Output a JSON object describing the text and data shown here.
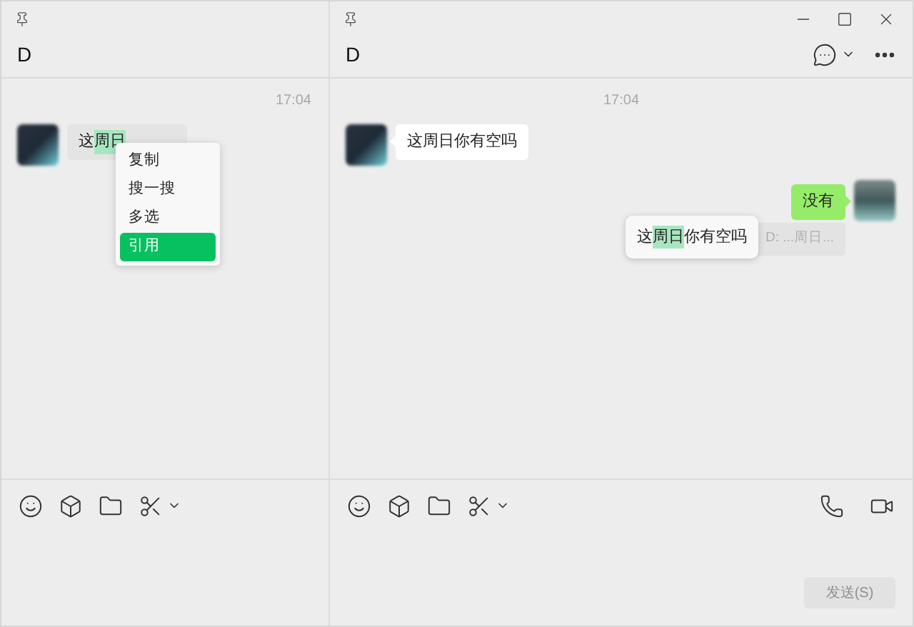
{
  "left_chat": {
    "title": "D",
    "timestamp": "17:04",
    "message": {
      "prefix": "这",
      "highlight": "周日"
    },
    "context_menu": [
      {
        "label": "复制",
        "selected": false
      },
      {
        "label": "搜一搜",
        "selected": false
      },
      {
        "label": "多选",
        "selected": false
      },
      {
        "label": "引用",
        "selected": true
      }
    ]
  },
  "right_chat": {
    "title": "D",
    "timestamp": "17:04",
    "messages": [
      {
        "kind": "incoming",
        "text": "这周日你有空吗"
      },
      {
        "kind": "outgoing",
        "text": "没有"
      }
    ],
    "quote_preview": {
      "prefix": "这",
      "highlight": "周日",
      "suffix": "你有空吗"
    },
    "quote_reference": "D: ...周日...",
    "send_button": {
      "label": "发送(S)",
      "disabled": true
    }
  }
}
